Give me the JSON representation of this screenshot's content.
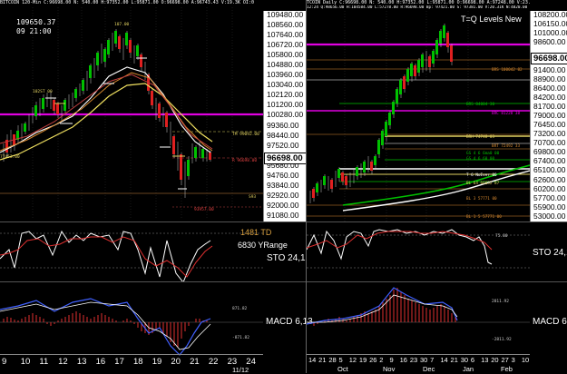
{
  "left_chart": {
    "header_line": "BITCOIN 120-Min C:96698.00 N: 540.00 H:97352.00 L:95871.00 O:96698.00 A:96743.43 V:19.3K OI:0",
    "price_label": "109650.37",
    "time_label": "09 21:00",
    "current_price": "96698.00",
    "y_axis_labels": [
      "109480.00",
      "108560.00",
      "107640.00",
      "106720.00",
      "105800.00",
      "104880.00",
      "103960.00",
      "103040.00",
      "102120.00",
      "101200.00",
      "100280.00",
      "99360.00",
      "98440.00",
      "97520.00",
      "96698.00",
      "95680.00",
      "94760.00",
      "93840.00",
      "92920.00",
      "92000.00",
      "91080.00"
    ],
    "x_axis_labels": [
      "9",
      "10",
      "11",
      "12",
      "13",
      "16",
      "17",
      "18",
      "19",
      "20",
      "21",
      "22",
      "23",
      "24"
    ],
    "x_axis_sub": "11/12",
    "td_label": "1481 TD",
    "yrange_label": "6830 YRange",
    "sto_label": "STO 24,1",
    "macd_label": "MACD 6,13",
    "level_text_1": "TM 99092.00",
    "level_text_2": "R 96698.00",
    "level_text_3": "S93",
    "level_text_4": "93957.00",
    "level_text_5": "102ST 00",
    "level_text_6": "107.00",
    "level_text_7": "77453.00",
    "macd_tick_1": "871.82",
    "macd_tick_2": "-871.82"
  },
  "right_chart": {
    "header_line": "TCOIN Daily C:96698.00 N: 540.00 H:97352.00 L:95871.00 O:96698.00 A:97248.00 V:23.9K OI:0",
    "sub_header": "12:24 Q:98656.00 H:104584.00 L:57278.00 R:96698.00 Bp: 97421.00 S: 97381.00 V:20.31K N:4820.00 D:1233.10 H:9672.30",
    "title": "T=Q Levels New",
    "current_price": "96698.00",
    "y_axis_labels": [
      "108200.00",
      "106150.00",
      "101000.00",
      "98600.00",
      "96698.00",
      "94200.00",
      "91400.00",
      "88900.00",
      "86400.00",
      "84200.00",
      "81700.00",
      "79000.00",
      "76450.00",
      "73200.00",
      "70700.00",
      "69800.00",
      "67400.00",
      "65100.00",
      "62600.00",
      "60200.00",
      "57700.00",
      "55900.00",
      "53000.00"
    ],
    "x_axis_labels": [
      "14",
      "21",
      "28",
      "5",
      "12",
      "19",
      "26",
      "2",
      "9",
      "16",
      "23",
      "30",
      "7",
      "14",
      "21",
      "30",
      "6",
      "13",
      "20",
      "27",
      "3",
      "10"
    ],
    "x_axis_months": [
      "Oct",
      "Nov",
      "Dec",
      "Jan",
      "Feb"
    ],
    "sto_label": "STO 24,1",
    "macd_label": "MACD 6,13",
    "sto_tick": "75.00",
    "macd_tick_1": "2811.92",
    "macd_tick_2": "-2811.92",
    "level_labels": [
      "BRS 100042 82",
      "BRS 84004 30",
      "BRC 81228 38",
      "BRH 74748 03",
      "BRT 72492 33",
      "GS 4 6 6ma0 00",
      "GS 4 6 60 00",
      "T 6 NoEver 00",
      "BL 64 66032 87",
      "BL 3 57771 00",
      "BL 1 5 57771 00"
    ]
  }
}
